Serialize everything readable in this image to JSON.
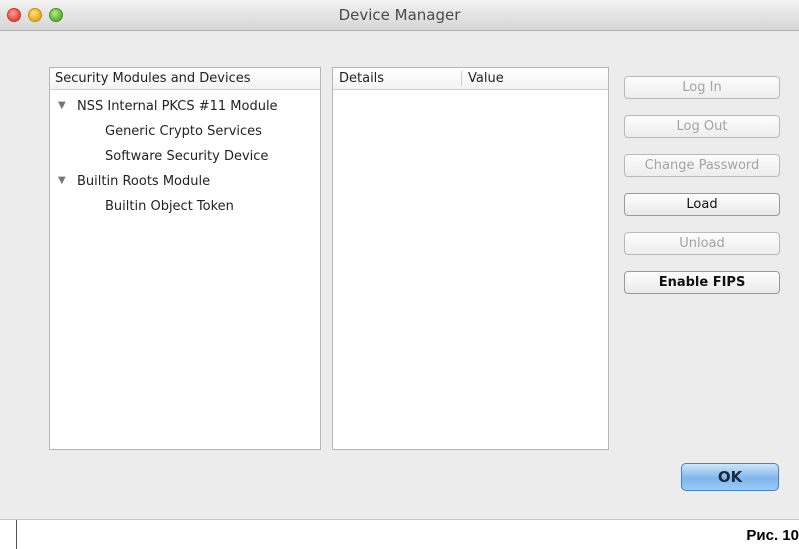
{
  "window": {
    "title": "Device Manager"
  },
  "tree_panel": {
    "header": "Security Modules and Devices",
    "items": [
      {
        "label": "NSS Internal PKCS #11 Module",
        "expanded": true,
        "level": 0
      },
      {
        "label": "Generic Crypto Services",
        "level": 1
      },
      {
        "label": "Software Security Device",
        "level": 1
      },
      {
        "label": "Builtin Roots Module",
        "expanded": true,
        "level": 0
      },
      {
        "label": "Builtin Object Token",
        "level": 1
      }
    ]
  },
  "details_panel": {
    "columns": [
      "Details",
      "Value"
    ]
  },
  "buttons": {
    "log_in": {
      "label": "Log In",
      "enabled": false
    },
    "log_out": {
      "label": "Log Out",
      "enabled": false
    },
    "change_password": {
      "label": "Change Password",
      "enabled": false
    },
    "load": {
      "label": "Load",
      "enabled": true
    },
    "unload": {
      "label": "Unload",
      "enabled": false
    },
    "enable_fips": {
      "label": "Enable FIPS",
      "enabled": true
    },
    "ok": {
      "label": "OK"
    }
  },
  "caption": "Рис. 10",
  "icons": {
    "close": "close-icon",
    "minimize": "minimize-icon",
    "maximize": "maximize-icon",
    "disclosure": "disclosure-triangle-icon"
  },
  "colors": {
    "window_background": "#ececec",
    "ok_accent": "#7fb6ec"
  }
}
